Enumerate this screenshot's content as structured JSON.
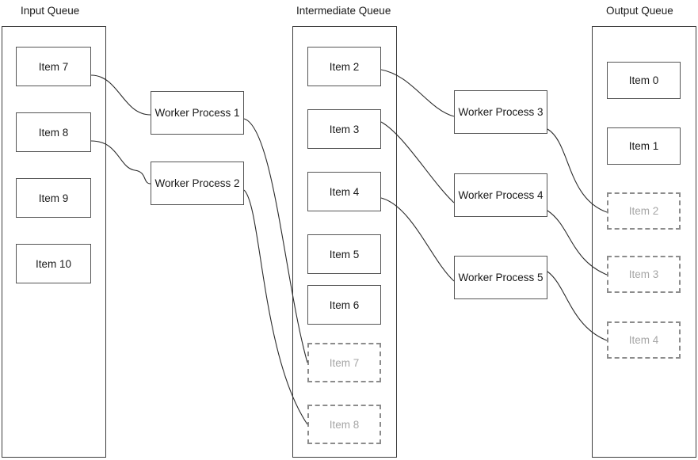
{
  "diagram": {
    "title_input": "Input Queue",
    "title_intermediate": "Intermediate Queue",
    "title_output": "Output Queue",
    "line_color": "#2b2b2b",
    "box_border_color": "#555555",
    "ghost_border_color": "#8c8c8c",
    "ghost_text_color": "#a6a6a6",
    "background": "#ffffff"
  },
  "input_queue": {
    "label": "Input Queue",
    "items": [
      {
        "label": "Item 7",
        "state": "solid"
      },
      {
        "label": "Item 8",
        "state": "solid"
      },
      {
        "label": "Item 9",
        "state": "solid"
      },
      {
        "label": "Item 10",
        "state": "solid"
      }
    ]
  },
  "intermediate_queue": {
    "label": "Intermediate Queue",
    "items": [
      {
        "label": "Item 2",
        "state": "solid"
      },
      {
        "label": "Item 3",
        "state": "solid"
      },
      {
        "label": "Item 4",
        "state": "solid"
      },
      {
        "label": "Item 5",
        "state": "solid"
      },
      {
        "label": "Item 6",
        "state": "solid"
      },
      {
        "label": "Item 7",
        "state": "ghost"
      },
      {
        "label": "Item 8",
        "state": "ghost"
      }
    ]
  },
  "output_queue": {
    "label": "Output Queue",
    "items": [
      {
        "label": "Item 0",
        "state": "solid"
      },
      {
        "label": "Item 1",
        "state": "solid"
      },
      {
        "label": "Item 2",
        "state": "ghost"
      },
      {
        "label": "Item 3",
        "state": "ghost"
      },
      {
        "label": "Item 4",
        "state": "ghost"
      }
    ]
  },
  "left_workers": [
    {
      "label": "Worker Process 1"
    },
    {
      "label": "Worker Process 2"
    }
  ],
  "right_workers": [
    {
      "label": "Worker Process 3"
    },
    {
      "label": "Worker Process 4"
    },
    {
      "label": "Worker Process 5"
    }
  ],
  "connections": [
    {
      "from": "Item 7",
      "to": "Worker Process 1"
    },
    {
      "from": "Item 8",
      "to": "Worker Process 2"
    },
    {
      "from": "Worker Process 1",
      "to": "Item 7 (intermediate)"
    },
    {
      "from": "Worker Process 2",
      "to": "Item 8 (intermediate)"
    },
    {
      "from": "Item 2",
      "to": "Worker Process 3"
    },
    {
      "from": "Item 3",
      "to": "Worker Process 4"
    },
    {
      "from": "Item 4",
      "to": "Worker Process 5"
    },
    {
      "from": "Worker Process 3",
      "to": "Item 2 (output)"
    },
    {
      "from": "Worker Process 4",
      "to": "Item 3 (output)"
    },
    {
      "from": "Worker Process 5",
      "to": "Item 4 (output)"
    }
  ]
}
